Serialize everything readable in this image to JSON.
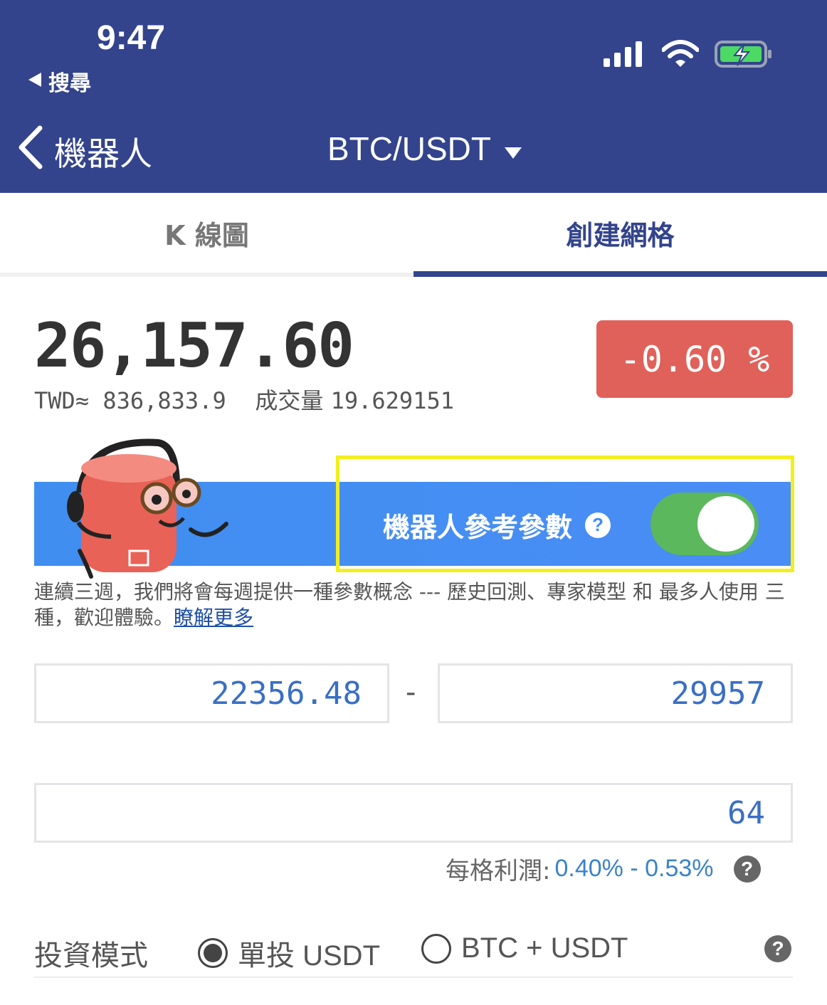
{
  "status_bar": {
    "time": "9:47",
    "back_label": "搜尋"
  },
  "nav": {
    "back_label": "機器人",
    "pair": "BTC/USDT"
  },
  "tabs": [
    {
      "label": "K 線圖"
    },
    {
      "label": "創建網格"
    }
  ],
  "ticker": {
    "price": "26,157.60",
    "twd": "TWD≈ 836,833.9",
    "volume_label": "成交量",
    "volume_value": "19.629151",
    "change": "-0.60 %"
  },
  "banner": {
    "label": "機器人參考參數",
    "toggle_on": true,
    "help_icon": "question-icon"
  },
  "description": {
    "text": "連續三週，我們將會每週提供一種參數概念 --- 歷史回測、專家模型 和 最多人使用 三種，歡迎體驗。",
    "link": "瞭解更多"
  },
  "range": {
    "low": "22356.48",
    "separator": "-",
    "high": "29957"
  },
  "grid_count": "64",
  "profit": {
    "label": "每格利潤:",
    "value": "0.40% - 0.53%"
  },
  "invest_mode": {
    "label": "投資模式",
    "options": [
      {
        "label": "單投 USDT",
        "selected": true
      },
      {
        "label": "BTC + USDT",
        "selected": false
      }
    ]
  },
  "colors": {
    "header": "#33448c",
    "negative": "#e06159",
    "toggle": "#5bb85c",
    "highlight": "#f3ee1e",
    "accent": "#3a6fc4"
  }
}
